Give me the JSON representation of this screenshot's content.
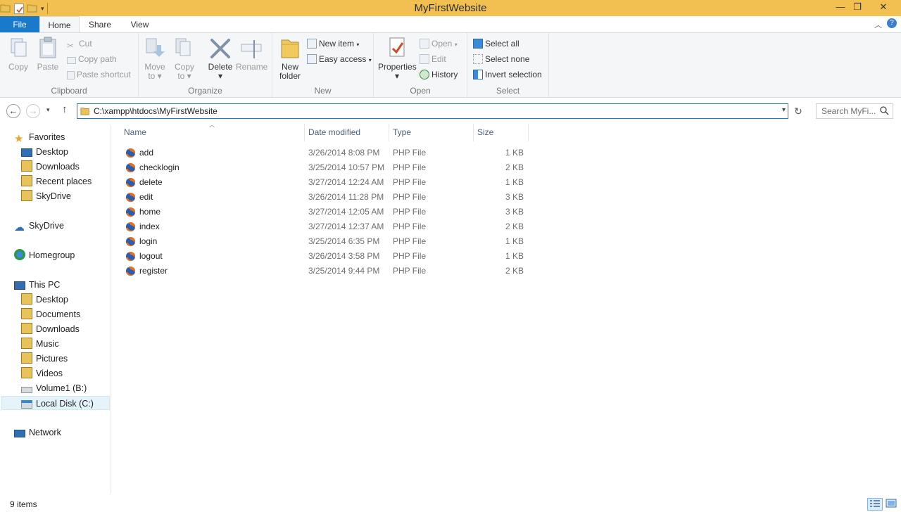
{
  "window": {
    "title": "MyFirstWebsite"
  },
  "ribbon_tabs": {
    "file": "File",
    "home": "Home",
    "share": "Share",
    "view": "View"
  },
  "clipboard": {
    "copy": "Copy",
    "paste": "Paste",
    "cut": "Cut",
    "copy_path": "Copy path",
    "paste_shortcut": "Paste shortcut",
    "label": "Clipboard"
  },
  "organize": {
    "move_to": [
      "Move",
      "to"
    ],
    "copy_to": [
      "Copy",
      "to"
    ],
    "delete": "Delete",
    "rename": "Rename",
    "label": "Organize"
  },
  "new": {
    "new_folder": [
      "New",
      "folder"
    ],
    "new_item": "New item",
    "easy_access": "Easy access",
    "label": "New"
  },
  "open": {
    "properties": "Properties",
    "open": "Open",
    "edit": "Edit",
    "history": "History",
    "label": "Open"
  },
  "select": {
    "select_all": "Select all",
    "select_none": "Select none",
    "invert": "Invert selection",
    "label": "Select"
  },
  "address": {
    "path": "C:\\xampp\\htdocs\\MyFirstWebsite"
  },
  "search": {
    "placeholder": "Search MyFi..."
  },
  "navpane": {
    "favorites": "Favorites",
    "fav_items": [
      "Desktop",
      "Downloads",
      "Recent places",
      "SkyDrive"
    ],
    "skydrive": "SkyDrive",
    "homegroup": "Homegroup",
    "thispc": "This PC",
    "pc_items": [
      "Desktop",
      "Documents",
      "Downloads",
      "Music",
      "Pictures",
      "Videos",
      "Volume1 (B:)",
      "Local Disk (C:)"
    ],
    "network": "Network"
  },
  "columns": {
    "name": "Name",
    "date": "Date modified",
    "type": "Type",
    "size": "Size"
  },
  "files": [
    {
      "name": "add",
      "date": "3/26/2014 8:08 PM",
      "type": "PHP File",
      "size": "1 KB"
    },
    {
      "name": "checklogin",
      "date": "3/25/2014 10:57 PM",
      "type": "PHP File",
      "size": "2 KB"
    },
    {
      "name": "delete",
      "date": "3/27/2014 12:24 AM",
      "type": "PHP File",
      "size": "1 KB"
    },
    {
      "name": "edit",
      "date": "3/26/2014 11:28 PM",
      "type": "PHP File",
      "size": "3 KB"
    },
    {
      "name": "home",
      "date": "3/27/2014 12:05 AM",
      "type": "PHP File",
      "size": "3 KB"
    },
    {
      "name": "index",
      "date": "3/27/2014 12:37 AM",
      "type": "PHP File",
      "size": "2 KB"
    },
    {
      "name": "login",
      "date": "3/25/2014 6:35 PM",
      "type": "PHP File",
      "size": "1 KB"
    },
    {
      "name": "logout",
      "date": "3/26/2014 3:58 PM",
      "type": "PHP File",
      "size": "1 KB"
    },
    {
      "name": "register",
      "date": "3/25/2014 9:44 PM",
      "type": "PHP File",
      "size": "2 KB"
    }
  ],
  "status": {
    "count": "9 items"
  },
  "colors": {
    "titlebar": "#f2c050",
    "file_tab": "#1979ca",
    "accent": "#1979ca"
  }
}
